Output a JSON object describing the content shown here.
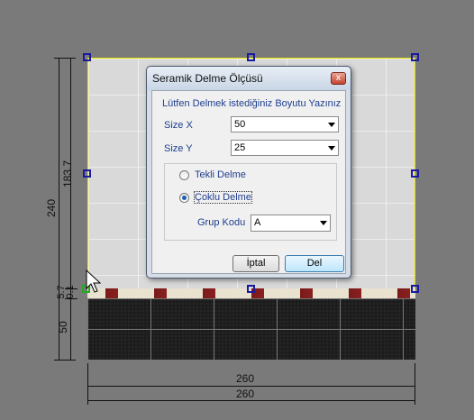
{
  "dialog": {
    "title": "Seramik Delme Ölçüsü",
    "close_label": "x",
    "prompt": "Lütfen Delmek istediğiniz Boyutu Yazınız",
    "size_x": {
      "label": "Size X",
      "value": "50"
    },
    "size_y": {
      "label": "Size Y",
      "value": "25"
    },
    "options": {
      "single": {
        "label": "Tekli Delme",
        "selected": false
      },
      "multi": {
        "label": "Çoklu Delme",
        "selected": true
      }
    },
    "group_code": {
      "label": "Grup Kodu",
      "value": "A"
    },
    "cancel_label": "İptal",
    "delete_label": "Del"
  },
  "drawing": {
    "dims": {
      "total_height": "240",
      "upper_height": "183.7",
      "strip_a": "5.7",
      "strip_b": "0.1",
      "lower_height": "50",
      "width_1": "260",
      "width_2": "260"
    },
    "colors": {
      "background": "#7a7a7a",
      "selection_handle": "#1a1aa0",
      "selection_outline": "#e6e600"
    }
  }
}
